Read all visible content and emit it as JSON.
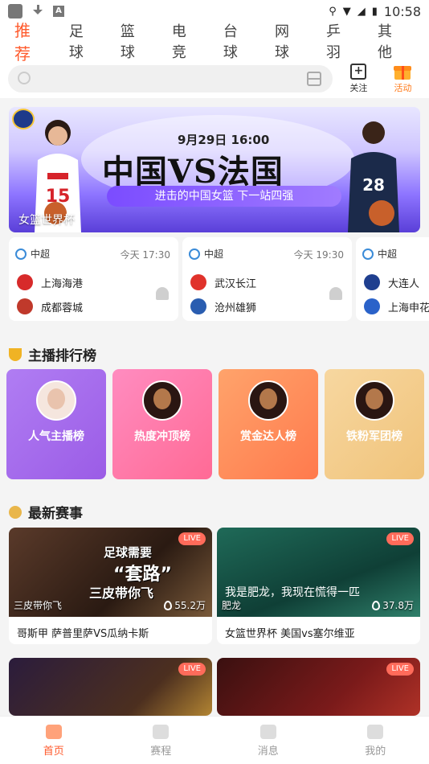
{
  "status_bar": {
    "time": "10:58"
  },
  "tabs": [
    {
      "label": "推荐",
      "active": true
    },
    {
      "label": "足球"
    },
    {
      "label": "篮球"
    },
    {
      "label": "电竞"
    },
    {
      "label": "台球"
    },
    {
      "label": "网球"
    },
    {
      "label": "乒羽"
    },
    {
      "label": "其他"
    }
  ],
  "search": {
    "placeholder": ""
  },
  "top_actions": {
    "follow_label": "关注",
    "activity_label": "活动"
  },
  "banner": {
    "date": "9月29日  16:00",
    "headline": "中国VS法国",
    "subtitle": "进击的中国女篮  下一站四强",
    "caption": "女篮世界杯"
  },
  "matches": [
    {
      "league": "中超",
      "time": "今天 17:30",
      "home": "上海海港",
      "away": "成都蓉城"
    },
    {
      "league": "中超",
      "time": "今天 19:30",
      "home": "武汉长江",
      "away": "沧州雄狮"
    },
    {
      "league": "中超",
      "time": "",
      "home": "大连人",
      "away": "上海申花"
    }
  ],
  "ranking_section": {
    "title": "主播排行榜"
  },
  "rankings": [
    {
      "label": "人气主播榜"
    },
    {
      "label": "热度冲顶榜"
    },
    {
      "label": "赏金达人榜"
    },
    {
      "label": "铁粉军团榜"
    }
  ],
  "events_section": {
    "title": "最新赛事"
  },
  "live_cards": [
    {
      "badge": "LIVE",
      "anchor": "三皮带你飞",
      "views": "55.2万",
      "title": "哥斯甲 萨普里萨VS瓜纳卡斯",
      "overlay": [
        "足球需要",
        "“套路”",
        "三皮带你飞"
      ]
    },
    {
      "badge": "LIVE",
      "anchor": "肥龙",
      "views": "37.8万",
      "title": "女篮世界杯 美国vs塞尔维亚",
      "overlay": [
        "我是肥龙，我现在慌得一匹"
      ]
    },
    {
      "badge": "LIVE"
    },
    {
      "badge": "LIVE"
    }
  ],
  "bottom_nav": [
    {
      "label": "首页",
      "active": true
    },
    {
      "label": "赛程"
    },
    {
      "label": "消息"
    },
    {
      "label": "我的"
    }
  ],
  "colors": {
    "accent": "#ff5a2c",
    "live": "#ff6b5a"
  }
}
